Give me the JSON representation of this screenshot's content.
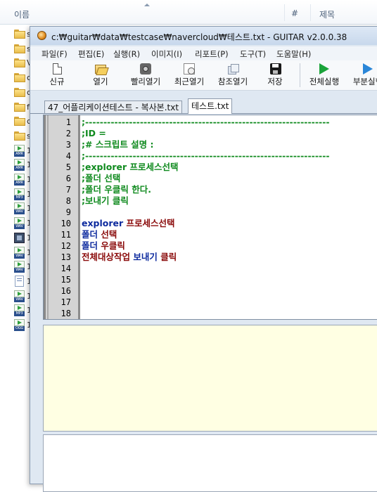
{
  "explorer": {
    "col_name": "이름",
    "col_num": "#",
    "col_title": "제목",
    "rows": [
      {
        "icon": "folder-icon",
        "letter": "s"
      },
      {
        "icon": "folder-icon",
        "letter": "s"
      },
      {
        "icon": "folder-icon",
        "letter": "V"
      },
      {
        "icon": "folder-icon",
        "letter": "c"
      },
      {
        "icon": "folder-icon",
        "letter": "c"
      },
      {
        "icon": "folder-icon",
        "letter": "f"
      },
      {
        "icon": "folder-icon",
        "letter": "c"
      },
      {
        "icon": "folder-icon",
        "letter": "s"
      },
      {
        "icon": "media-icon",
        "tag": "AMR",
        "letter": "1"
      },
      {
        "icon": "media-icon",
        "tag": "AMR",
        "letter": "1"
      },
      {
        "icon": "media-icon",
        "tag": "AMR",
        "letter": "1"
      },
      {
        "icon": "media-icon",
        "tag": "MP3",
        "letter": "1"
      },
      {
        "icon": "media-icon",
        "tag": "WAV",
        "letter": "1"
      },
      {
        "icon": "media-icon",
        "tag": "WAV",
        "letter": "1"
      },
      {
        "icon": "rm-icon",
        "tag": "RM",
        "letter": "1"
      },
      {
        "icon": "media-icon",
        "tag": "WAV",
        "letter": "1"
      },
      {
        "icon": "media-icon",
        "tag": "WAV",
        "letter": "1"
      },
      {
        "icon": "doc-icon",
        "letter": "1"
      },
      {
        "icon": "media-icon",
        "tag": "WAV",
        "letter": "1"
      },
      {
        "icon": "media-icon",
        "tag": "MP3",
        "letter": "1"
      },
      {
        "icon": "media-icon",
        "tag": "OGG",
        "letter": "1"
      }
    ]
  },
  "window": {
    "title": "c:₩guitar₩data₩testcase₩navercloud₩테스트.txt - GUITAR v2.0.0.38"
  },
  "menu": [
    "파일(F)",
    "편집(E)",
    "실행(R)",
    "이미지(I)",
    "리포트(P)",
    "도구(T)",
    "도움말(H)"
  ],
  "toolbar": {
    "new": "신규",
    "open": "열기",
    "quick_open": "빨리열기",
    "recent_open": "최근열기",
    "ref_open": "참조열기",
    "save": "저장",
    "run_all": "전체실행",
    "run_partial": "부분실행"
  },
  "tabs": [
    "47_어플리케이션테스트 - 복사본.txt",
    "테스트.txt"
  ],
  "editor": {
    "line_numbers": [
      "1",
      "2",
      "3",
      "4",
      "5",
      "6",
      "7",
      "8",
      "9",
      "10",
      "11",
      "12",
      "13",
      "14",
      "15",
      "16",
      "17",
      "18"
    ],
    "line1": ";-------------------------------------------------------------------",
    "line2": ";ID =",
    "line3": ";# 스크립트 설명 :",
    "line4": ";-------------------------------------------------------------------",
    "line5": ";explorer 프로세스선택",
    "line6": ";폴더 선택",
    "line7": ";폴더 우클릭 한다.",
    "line8": ";보내기 클릭",
    "line10_a": "explorer ",
    "line10_b": "프로세스선택",
    "line11_a": "폴더 ",
    "line11_b": "선택",
    "line12_a": "폴더 ",
    "line12_b": "우클릭",
    "line13_a": "전체대상작업 ",
    "line13_b": "보내기 ",
    "line13_c": "클릭"
  }
}
